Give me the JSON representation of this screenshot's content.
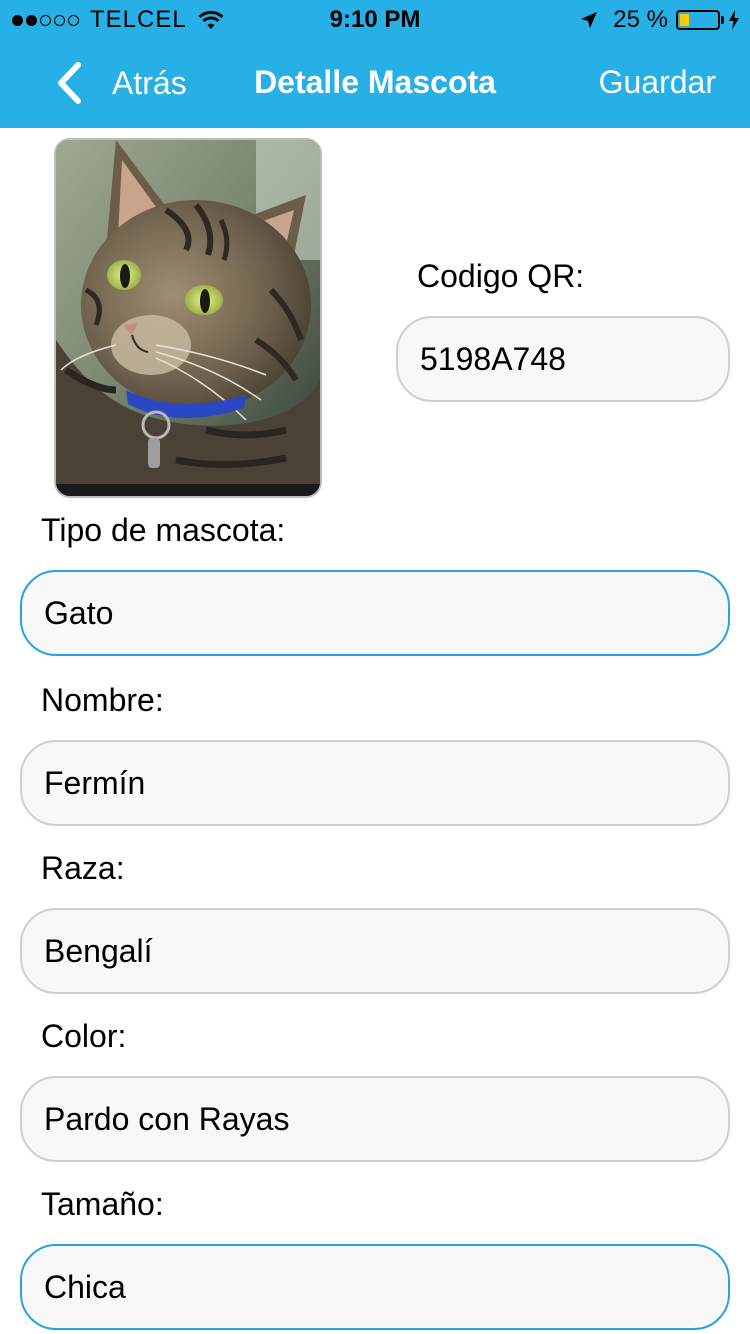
{
  "status_bar": {
    "carrier": "TELCEL",
    "time": "9:10 PM",
    "battery_text": "25 %",
    "battery_level": 0.25,
    "signal_bars_filled": 2,
    "signal_bars_total": 5
  },
  "nav": {
    "back_label": "Atrás",
    "title": "Detalle Mascota",
    "save_label": "Guardar"
  },
  "qr": {
    "label": "Codigo QR:",
    "value": "5198A748"
  },
  "fields": {
    "tipo": {
      "label": "Tipo de mascota:",
      "value": "Gato"
    },
    "nombre": {
      "label": "Nombre:",
      "value": "Fermín"
    },
    "raza": {
      "label": "Raza:",
      "value": "Bengalí"
    },
    "color": {
      "label": "Color:",
      "value": "Pardo con Rayas"
    },
    "tamano": {
      "label": "Tamaño:",
      "value": "Chica"
    }
  },
  "colors": {
    "nav_background": "#27b0e6",
    "focused_border": "#27a4dc",
    "field_border": "#cfcfcf",
    "field_background": "#f8f8f8"
  }
}
